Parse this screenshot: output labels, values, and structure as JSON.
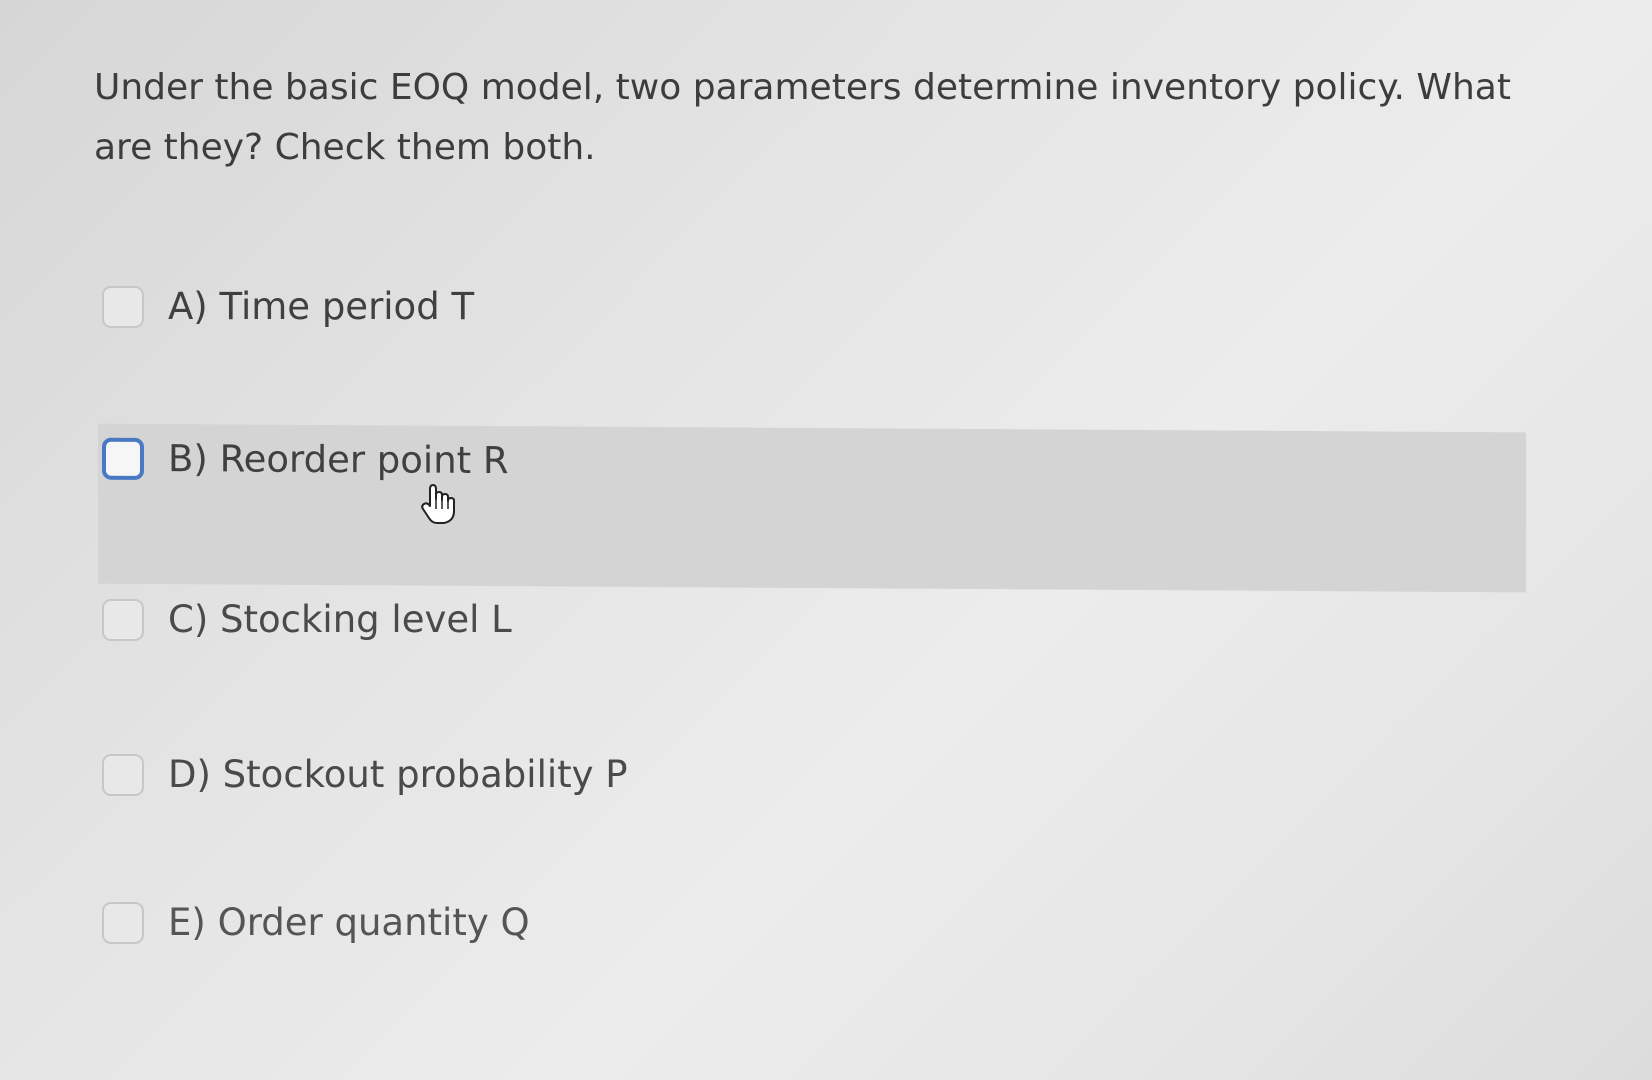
{
  "question": {
    "text": "Under the basic EOQ model, two parameters determine inventory policy. What are they? Check them both."
  },
  "options": [
    {
      "label": "A) Time period T",
      "checked": false
    },
    {
      "label": "B) Reorder point R",
      "checked": false
    },
    {
      "label": "C) Stocking level L",
      "checked": false
    },
    {
      "label": "D) Stockout probability P",
      "checked": false
    },
    {
      "label": "E) Order quantity Q",
      "checked": false
    }
  ],
  "colors": {
    "background": "#e4e4e4",
    "hover_row": "#d4d4d4",
    "focus_border": "#4a79c4",
    "text": "#3f3f3f"
  },
  "cursor": {
    "icon": "hand-pointer-icon"
  }
}
